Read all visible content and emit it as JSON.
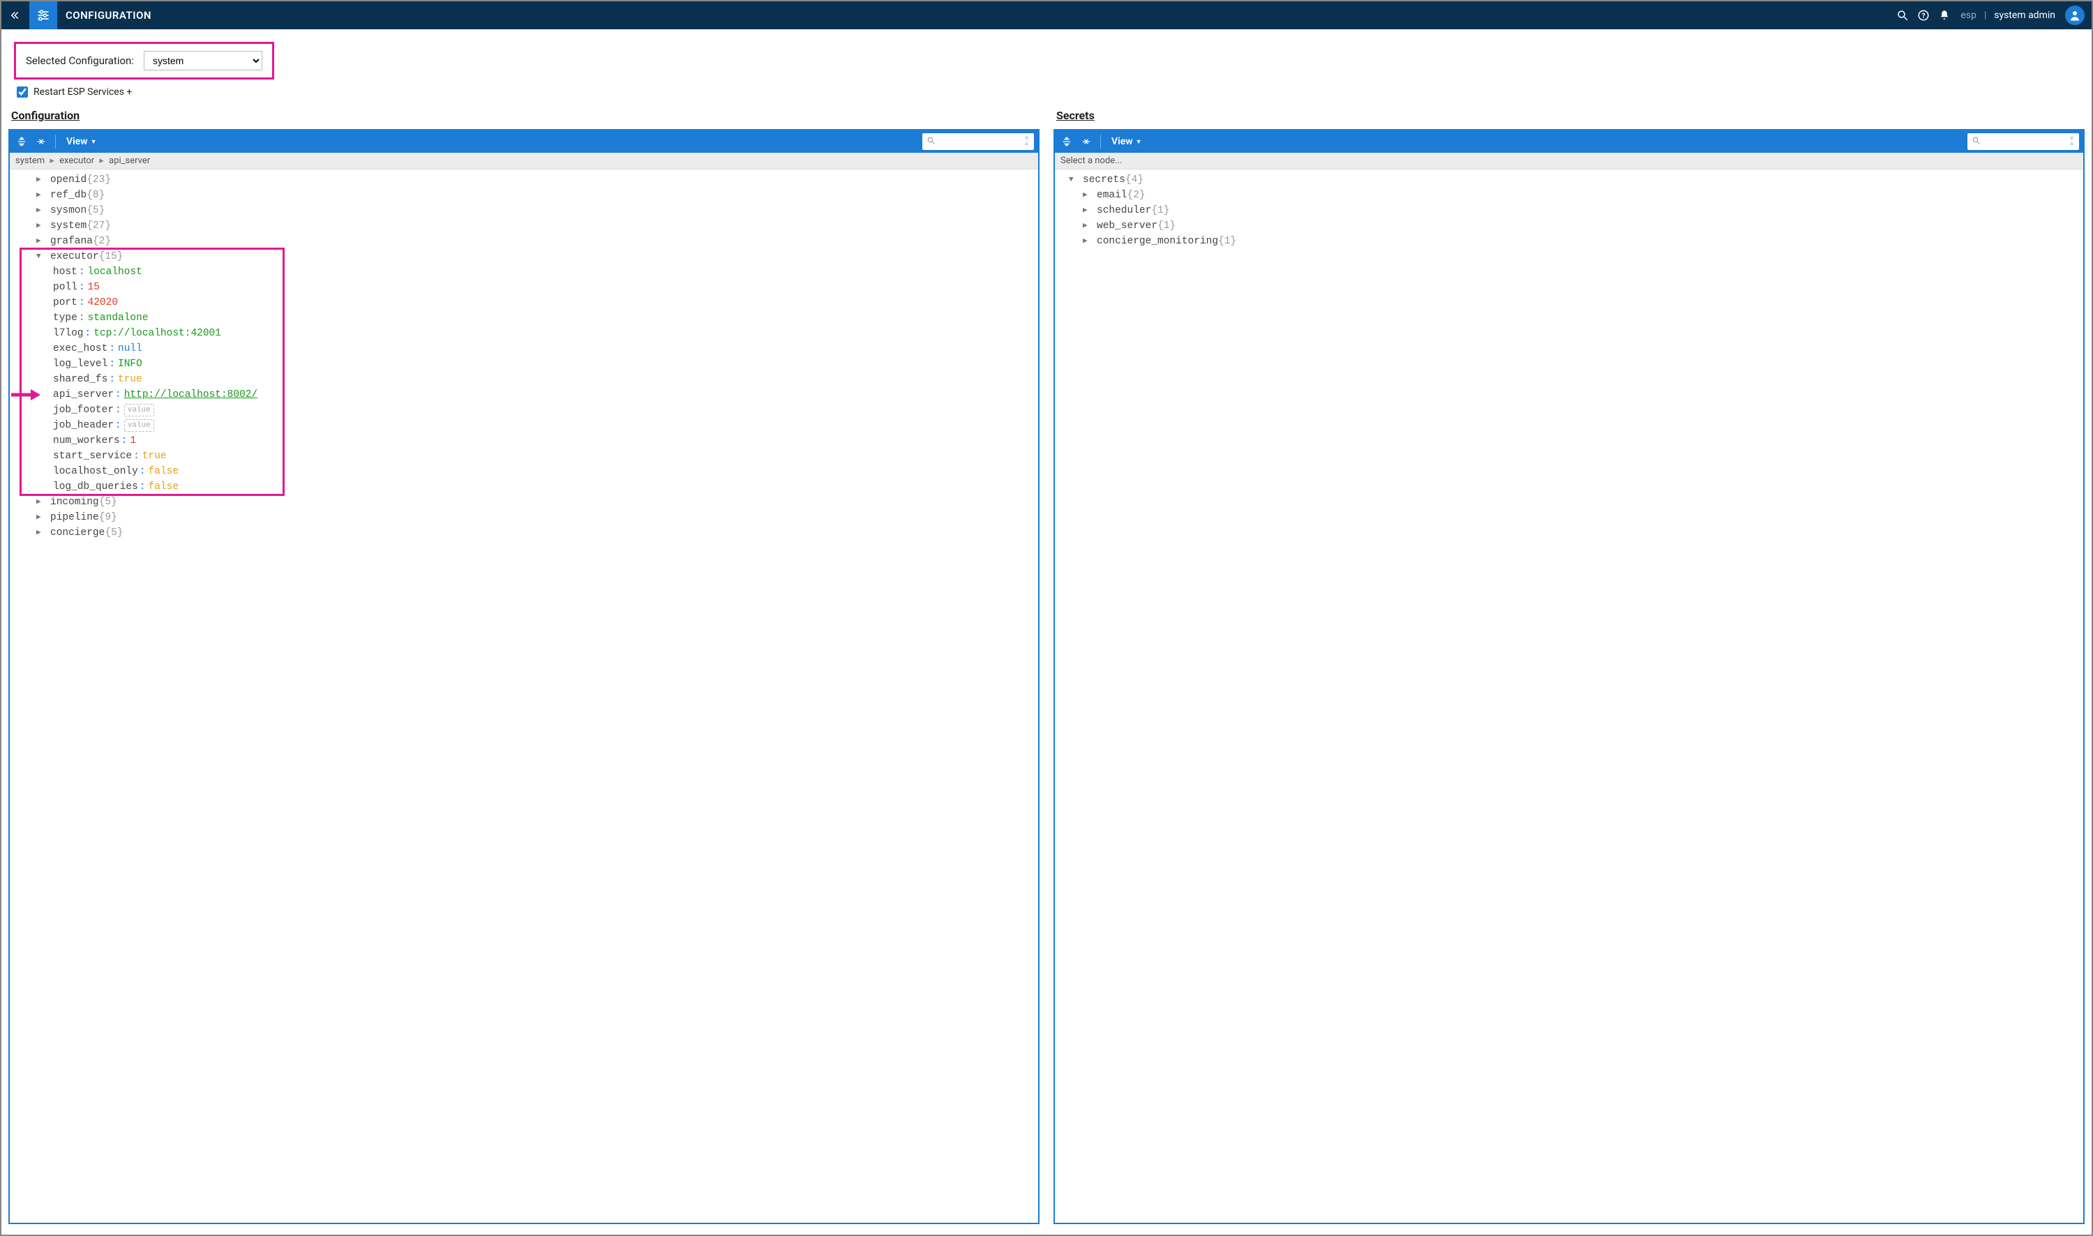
{
  "topbar": {
    "title": "CONFIGURATION",
    "context": "esp",
    "user": "system admin"
  },
  "selected_config": {
    "label": "Selected Configuration:",
    "value": "system"
  },
  "restart": {
    "label": "Restart ESP Services +",
    "checked": true
  },
  "left_panel": {
    "title": "Configuration",
    "view_label": "View",
    "breadcrumb": [
      "system",
      "executor",
      "api_server"
    ],
    "tree": {
      "before": [
        {
          "key": "openid",
          "count": 23
        },
        {
          "key": "ref_db",
          "count": 8
        },
        {
          "key": "sysmon",
          "count": 5
        },
        {
          "key": "system",
          "count": 27
        },
        {
          "key": "grafana",
          "count": 2
        }
      ],
      "executor": {
        "key": "executor",
        "count": 15,
        "items": [
          {
            "k": "host",
            "v": "localhost",
            "t": "str"
          },
          {
            "k": "poll",
            "v": "15",
            "t": "num"
          },
          {
            "k": "port",
            "v": "42020",
            "t": "num"
          },
          {
            "k": "type",
            "v": "standalone",
            "t": "str"
          },
          {
            "k": "l7log",
            "v": "tcp://localhost:42001",
            "t": "str"
          },
          {
            "k": "exec_host",
            "v": "null",
            "t": "null"
          },
          {
            "k": "log_level",
            "v": "INFO",
            "t": "str"
          },
          {
            "k": "shared_fs",
            "v": "true",
            "t": "bool"
          },
          {
            "k": "api_server",
            "v": "http://localhost:8002/",
            "t": "url"
          },
          {
            "k": "job_footer",
            "v": "value",
            "t": "empty"
          },
          {
            "k": "job_header",
            "v": "value",
            "t": "empty"
          },
          {
            "k": "num_workers",
            "v": "1",
            "t": "num"
          },
          {
            "k": "start_service",
            "v": "true",
            "t": "bool"
          },
          {
            "k": "localhost_only",
            "v": "false",
            "t": "bool"
          },
          {
            "k": "log_db_queries",
            "v": "false",
            "t": "bool"
          }
        ]
      },
      "after": [
        {
          "key": "incoming",
          "count": 5
        },
        {
          "key": "pipeline",
          "count": 9
        },
        {
          "key": "concierge",
          "count": 5
        }
      ]
    }
  },
  "right_panel": {
    "title": "Secrets",
    "view_label": "View",
    "status": "Select a node...",
    "root": {
      "key": "secrets",
      "count": 4
    },
    "children": [
      {
        "key": "email",
        "count": 2
      },
      {
        "key": "scheduler",
        "count": 1
      },
      {
        "key": "web_server",
        "count": 1
      },
      {
        "key": "concierge_monitoring",
        "count": 1
      }
    ]
  }
}
